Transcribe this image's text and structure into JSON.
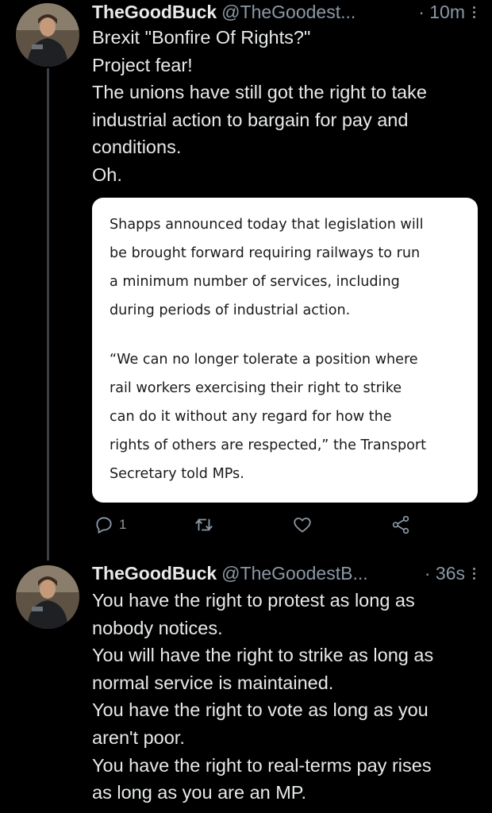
{
  "tweets": [
    {
      "name": "TheGoodBuck",
      "handle": "@TheGoodest...",
      "time": "· 10m",
      "lines": [
        "Brexit \"Bonfire Of Rights?\"",
        "Project fear!",
        "The unions have still got the right to take",
        "industrial action to bargain for pay and",
        "conditions.",
        "Oh."
      ],
      "quote": {
        "para1": [
          "Shapps announced today that legislation will",
          "be brought forward requiring railways to run",
          "a minimum number of services, including",
          "during periods of industrial action."
        ],
        "para2": [
          "“We can no longer tolerate a position where",
          "rail workers exercising their right to strike",
          "can do it without any regard for how the",
          "rights of others are respected,” the Transport",
          "Secretary told MPs."
        ]
      },
      "actions": {
        "reply_count": "1",
        "reply_icon": "reply-icon",
        "retweet_icon": "retweet-icon",
        "like_icon": "like-icon",
        "share_icon": "share-icon"
      }
    },
    {
      "name": "TheGoodBuck",
      "handle": "@TheGoodestB...",
      "time": "· 36s",
      "lines": [
        "You have the right to protest as long as",
        "nobody notices.",
        "You will have the right to strike as long as",
        "normal service is maintained.",
        "You have the right to vote as long as you",
        "aren't poor.",
        "You have the right to real-terms pay rises",
        "as long as you are an MP."
      ]
    }
  ],
  "colors": {
    "background": "#000000",
    "text": "#e7e9ea",
    "secondary": "#8b98a5",
    "quote_bg": "#ffffff",
    "thread_line": "#3a3f44"
  }
}
